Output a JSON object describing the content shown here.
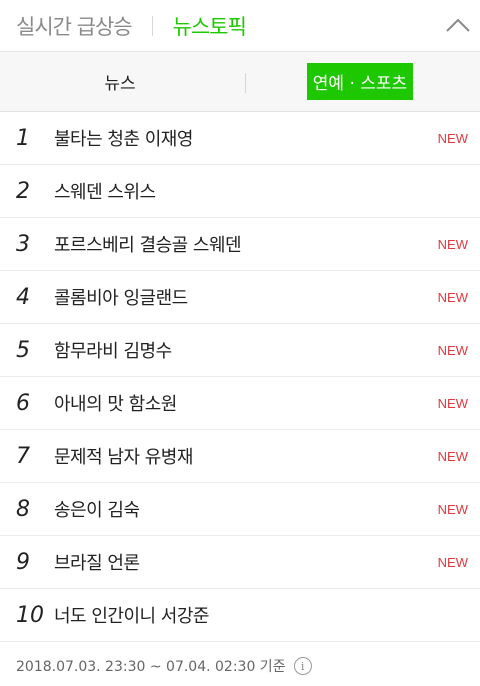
{
  "header": {
    "tab_realtime": "실시간 급상승",
    "tab_newstopic": "뉴스토픽",
    "collapse_icon": "chevron-up-icon"
  },
  "subtabs": {
    "news": "뉴스",
    "entertainment_sports": "연예 · 스포츠",
    "selected": "entertainment_sports"
  },
  "colors": {
    "accent": "#1ec800",
    "new_badge": "#e0383e"
  },
  "ranking": [
    {
      "rank": "1",
      "keyword": "불타는 청춘 이재영",
      "badge": "NEW"
    },
    {
      "rank": "2",
      "keyword": "스웨덴 스위스",
      "badge": ""
    },
    {
      "rank": "3",
      "keyword": "포르스베리 결승골 스웨덴",
      "badge": "NEW"
    },
    {
      "rank": "4",
      "keyword": "콜롬비아 잉글랜드",
      "badge": "NEW"
    },
    {
      "rank": "5",
      "keyword": "함무라비 김명수",
      "badge": "NEW"
    },
    {
      "rank": "6",
      "keyword": "아내의 맛 함소원",
      "badge": "NEW"
    },
    {
      "rank": "7",
      "keyword": "문제적 남자 유병재",
      "badge": "NEW"
    },
    {
      "rank": "8",
      "keyword": "송은이 김숙",
      "badge": "NEW"
    },
    {
      "rank": "9",
      "keyword": "브라질 언론",
      "badge": "NEW"
    },
    {
      "rank": "10",
      "keyword": "너도 인간이니 서강준",
      "badge": ""
    }
  ],
  "footer": {
    "timestamp": "2018.07.03. 23:30 ~ 07.04. 02:30 기준",
    "info_icon": "i"
  }
}
